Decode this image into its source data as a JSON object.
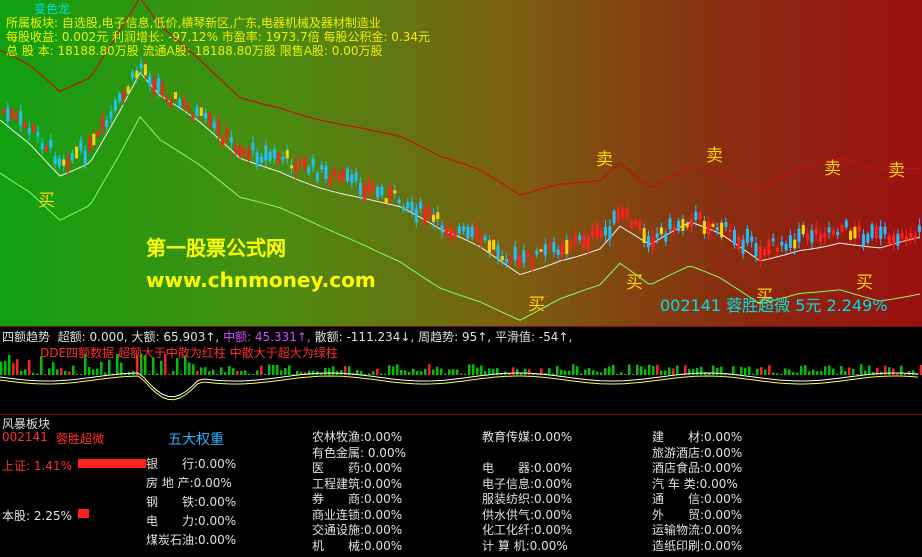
{
  "header": {
    "top_label": "变色龙",
    "sector_line": "所属板块: 自选股,电子信息,低价,横琴新区,广东,电器机械及器材制造业",
    "eps_line": "每股收益:  0.002元    利润增长: -97.12%    市盈率: 1973.7倍   每股公积金: 0.34元",
    "share_line": "总 股 本:  18188.80万股 流通A股: 18188.80万股   限售A股: 0.00万股"
  },
  "signals": {
    "buy": "买",
    "sell": "卖"
  },
  "watermark": {
    "name": "第一股票公式网",
    "url": "www.chnmoney.com"
  },
  "stock_info": "002141  蓉胜超微  5元  2.249%",
  "indicator": {
    "title": "四额趋势",
    "super": "超额: 0.000,",
    "big": "大额: 65.903↑,",
    "mid": "中额: 45.331↑,",
    "scatter": "散额: -111.234↓,",
    "weekly": "周趋势: 95↑,",
    "smooth": "平滑值: -54↑,",
    "legend": "DDE四额数据   超额大于中散为红柱   中散大于超大为绿柱"
  },
  "sector_panel": {
    "title": "风暴板块",
    "code": "002141",
    "stock_name": "蓉胜超微",
    "weights_title": "五大权重",
    "index_label": "上证: 1.41%",
    "own_label": "本股: 2.25%",
    "index_pct": 1.41,
    "own_pct": 2.25,
    "col1": [
      "银　　行:0.00%",
      "房 地 产:0.00%",
      "钢　　铁:0.00%",
      "电　　力:0.00%",
      "煤炭石油:0.00%"
    ],
    "col2": [
      "农林牧渔:0.00%",
      "有色金属: 0.00%",
      "医　　药:0.00%",
      "工程建筑:0.00%",
      "券　　商:0.00%",
      "商业连锁:0.00%",
      "交通设施:0.00%",
      "机　　械:0.00%"
    ],
    "col3": [
      "教育传媒:0.00%",
      "",
      "电　　器:0.00%",
      "电子信息:0.00%",
      "服装纺织:0.00%",
      "供水供气:0.00%",
      "化工化纤:0.00%",
      "计 算 机:0.00%"
    ],
    "col4": [
      "建　　材:0.00%",
      "旅游酒店:0.00%",
      "酒店食品:0.00%",
      "汽 车 类:0.00%",
      "通　　信:0.00%",
      "外　　贸:0.00%",
      "运输物流:0.00%",
      "造纸印刷:0.00%"
    ]
  },
  "colors": {
    "up": "#ff2020",
    "down": "#20c0ff",
    "signal": "#ffd400",
    "bar_green": "#00c000",
    "bar_red": "#ff2020"
  }
}
